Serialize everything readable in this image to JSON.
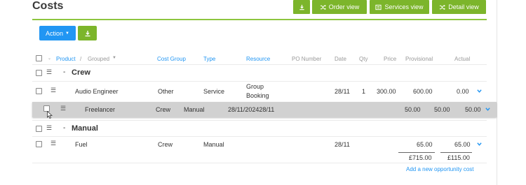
{
  "page": {
    "title": "Costs"
  },
  "toolbar": {
    "order_view": "Order view",
    "services_view": "Services view",
    "detail_view": "Detail view"
  },
  "actions": {
    "action_label": "Action"
  },
  "columns": {
    "product": "Product",
    "separator": "/",
    "grouped": "Grouped",
    "cost_group": "Cost Group",
    "type": "Type",
    "resource": "Resource",
    "po_number": "PO Number",
    "date": "Date",
    "qty": "Qty",
    "price": "Price",
    "provisional": "Provisional",
    "actual": "Actual"
  },
  "groups": [
    {
      "title": "Crew"
    },
    {
      "title": "Manual"
    }
  ],
  "rows": [
    {
      "product": "Audio Engineer",
      "cost_group": "Other",
      "type": "Service",
      "resource_line1": "Group",
      "resource_line2": "Booking",
      "date": "28/11",
      "qty": "1",
      "price": "300.00",
      "provisional": "600.00",
      "actual": "0.00"
    },
    {
      "product": "Freelancer",
      "cost_group": "Crew",
      "type": "Manual",
      "date_range": "28/11/202428/11",
      "price": "50.00",
      "provisional": "50.00",
      "actual": "50.00"
    },
    {
      "product": "Fuel",
      "cost_group": "Crew",
      "type": "Manual",
      "date": "28/11",
      "provisional": "65.00",
      "actual": "65.00"
    }
  ],
  "totals": {
    "provisional": "£715.00",
    "actual": "£115.00"
  },
  "footer": {
    "add_link": "Add a new opportunity cost"
  },
  "colors": {
    "accent_green": "#7cb52b",
    "accent_blue": "#2196f3",
    "highlight_row": "#d1d1d1"
  },
  "icons": [
    "download-icon",
    "shuffle-icon",
    "services-icon",
    "chevron-down-icon",
    "drag-handle-icon",
    "cursor-icon"
  ]
}
